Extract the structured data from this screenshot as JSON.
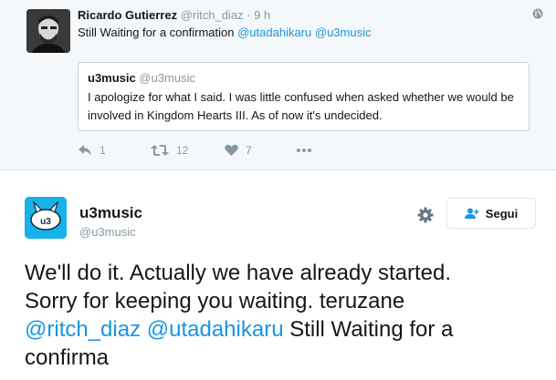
{
  "quoted_tweet": {
    "author_name": "Ricardo Gutierrez",
    "author_handle": "@ritch_diaz",
    "separator": "·",
    "time": "9 h",
    "text": "Still Waiting for a confirmation",
    "mention_1": "@utadahikaru",
    "mention_2": "@u3music",
    "globe_icon": "globe-icon",
    "quote": {
      "author_name": "u3music",
      "author_handle": "@u3music",
      "text": "I apologize for what I said. I was little confused when asked whether we would be involved in Kingdom Hearts III. As of now it's undecided."
    },
    "actions": {
      "reply_count": "1",
      "retweet_count": "12",
      "like_count": "7",
      "icons": [
        "reply-icon",
        "retweet-icon",
        "heart-icon",
        "more-icon"
      ]
    }
  },
  "main_tweet": {
    "author_name": "u3music",
    "author_handle": "@u3music",
    "follow_label": "Segui",
    "text_line_1": "We'll do it. Actually we have already started.",
    "text_line_2": "Sorry for keeping you waiting. teruzane",
    "mention_1": "@ritch_diaz",
    "mention_2": "@utadahikaru",
    "text_tail": "Still Waiting for a",
    "text_line_4": "confirma"
  },
  "colors": {
    "link": "#1b95e0",
    "muted": "#8899a6",
    "text": "#14171a",
    "avatar_bg": "#18b1e8",
    "quoted_bg": "#f5f8fa"
  }
}
